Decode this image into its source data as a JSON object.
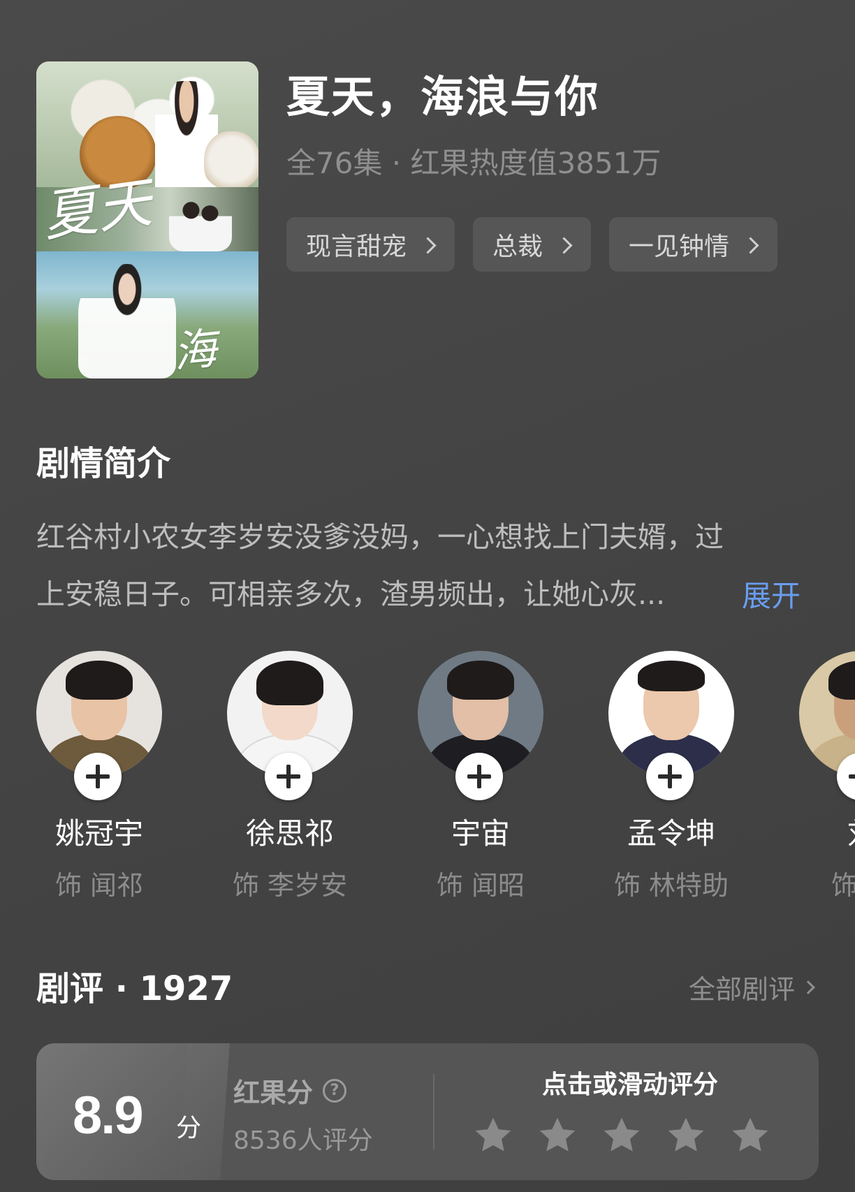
{
  "drama": {
    "title": "夏天，海浪与你",
    "meta": "全76集 · 红果热度值3851万",
    "poster_alt": "夏天海浪与你",
    "tags": [
      "现言甜宠",
      "总裁",
      "一见钟情"
    ]
  },
  "synopsis": {
    "heading": "剧情简介",
    "line1": "红谷村小农女李岁安没爹没妈，一心想找上门夫婿，过",
    "line2": "上安稳日子。可相亲多次，渣男频出，让她心灰...",
    "expand_label": "展开"
  },
  "cast": [
    {
      "name": "姚冠宇",
      "role": "饰 闻祁",
      "body_color": "#6e5a3c"
    },
    {
      "name": "徐思祁",
      "role": "饰 李岁安",
      "body_color": "#f5f5f5"
    },
    {
      "name": "宇宙",
      "role": "饰 闻昭",
      "body_color": "#1e1e22"
    },
    {
      "name": "孟令坤",
      "role": "饰 林特助",
      "body_color": "#2d2f4a"
    },
    {
      "name": "刘",
      "role": "饰 婷",
      "body_color": "#c7b28a"
    }
  ],
  "reviews": {
    "heading": "剧评 · 1927",
    "all_label": "全部剧评",
    "score": "8.9",
    "score_unit": "分",
    "score_label": "红果分",
    "rating_count": "8536人评分",
    "rate_prompt": "点击或滑动评分",
    "stars_filled": 0,
    "stars_total": 5
  },
  "icons": {
    "tag_chevron": "chevron-right-icon",
    "follow": "plus-icon",
    "help": "question-circle-icon",
    "star": "star-icon"
  },
  "colors": {
    "background": "#454545",
    "tag_bg": "#565656",
    "expand_link": "#6a9df0",
    "muted_text": "#8f8f8f",
    "star": "#8a8a8a"
  }
}
